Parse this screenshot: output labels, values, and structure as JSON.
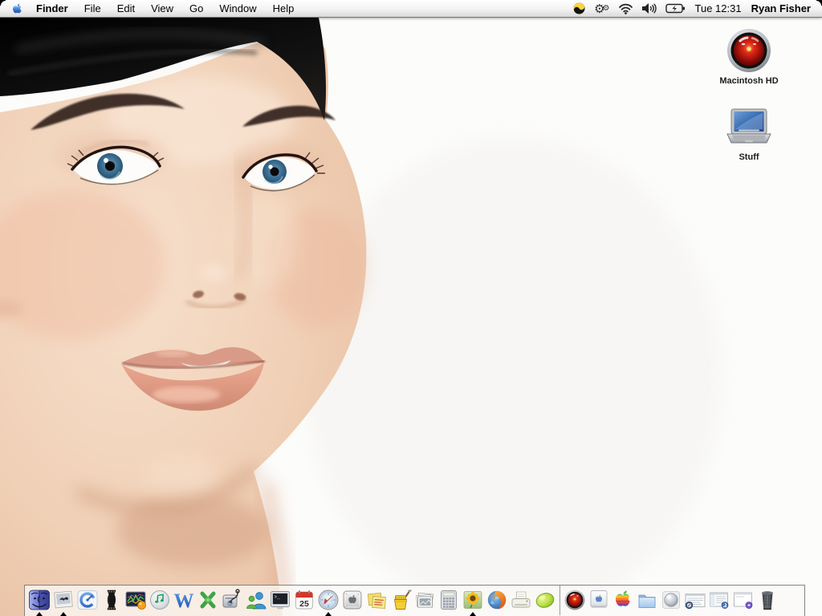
{
  "menu_bar": {
    "menus": [
      "Finder",
      "File",
      "Edit",
      "View",
      "Go",
      "Window",
      "Help"
    ],
    "status_icons": [
      {
        "name": "classic-swirl-icon"
      },
      {
        "name": "gears-icon"
      },
      {
        "name": "wifi-icon"
      },
      {
        "name": "volume-icon"
      },
      {
        "name": "battery-charging-icon"
      }
    ],
    "clock": "Tue 12:31",
    "user_name": "Ryan Fisher"
  },
  "desktop": {
    "wallpaper_description": "close-up portrait photo of a woman with dark hair and blue eyes on a white background",
    "icons": [
      {
        "label": "Macintosh HD",
        "icon": "hal9000-eye-icon"
      },
      {
        "label": "Stuff",
        "icon": "powerbook-laptop-icon"
      }
    ]
  },
  "dock": {
    "apps": [
      {
        "name": "finder",
        "running": true
      },
      {
        "name": "bird-photo-viewer",
        "running": true
      },
      {
        "name": "quicktime-player",
        "running": false
      },
      {
        "name": "film-spool-app",
        "running": false
      },
      {
        "name": "waveform-monitor-app",
        "running": false
      },
      {
        "name": "itunes",
        "running": false
      },
      {
        "name": "microsoft-word",
        "running": false,
        "glyph": "W"
      },
      {
        "name": "green-figure-app",
        "running": false
      },
      {
        "name": "disk-doctor",
        "running": false
      },
      {
        "name": "msn-messenger",
        "running": false
      },
      {
        "name": "terminal",
        "running": false
      },
      {
        "name": "ical",
        "running": false,
        "glyph": "25"
      },
      {
        "name": "safari",
        "running": true
      },
      {
        "name": "apple-plate-app",
        "running": false
      },
      {
        "name": "stickies",
        "running": false
      },
      {
        "name": "mop-bucket-app",
        "running": false
      },
      {
        "name": "photo-stack-app",
        "running": false
      },
      {
        "name": "calculator",
        "running": false
      },
      {
        "name": "sunflower-image-app",
        "running": true
      },
      {
        "name": "firefox",
        "running": false
      },
      {
        "name": "printer-utility",
        "running": false
      },
      {
        "name": "limewire",
        "running": false
      }
    ],
    "right_items": [
      {
        "name": "hal9000-volume"
      },
      {
        "name": "g4-cube"
      },
      {
        "name": "rainbow-apple"
      },
      {
        "name": "blue-folder"
      },
      {
        "name": "silver-sphere"
      },
      {
        "name": "minimized-window-safari"
      },
      {
        "name": "minimized-window-finder"
      },
      {
        "name": "minimized-window-plain"
      },
      {
        "name": "trash"
      }
    ]
  }
}
